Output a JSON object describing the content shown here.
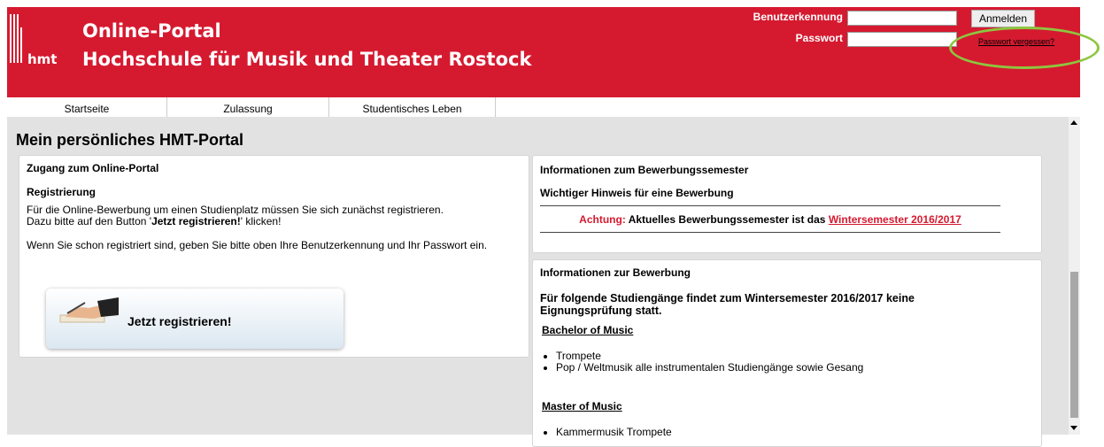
{
  "header": {
    "logo_text": "hmt",
    "title_line1": "Online-Portal",
    "title_line2": "Hochschule für Musik und Theater Rostock",
    "username_label": "Benutzerkennung",
    "password_label": "Passwort",
    "username_value": "",
    "password_value": "",
    "login_button": "Anmelden",
    "forgot_password": "Passwort vergessen?"
  },
  "nav": {
    "tabs": [
      "Startseite",
      "Zulassung",
      "Studentisches Leben"
    ]
  },
  "main": {
    "page_title": "Mein persönliches HMT-Portal",
    "access_panel": {
      "heading": "Zugang zum Online-Portal",
      "subheading": "Registrierung",
      "line1": "Für die Online-Bewerbung um einen Studienplatz müssen Sie sich zunächst registrieren.",
      "line2_prefix": "Dazu bitte auf den Button '",
      "line2_bold": "Jetzt registrieren!",
      "line2_suffix": "' klicken!",
      "line3": "Wenn Sie schon registriert sind, geben Sie bitte oben Ihre Benutzerkennung und Ihr Passwort ein.",
      "register_button": "Jetzt registrieren!"
    },
    "semester_panel": {
      "heading": "Informationen zum Bewerbungssemester",
      "subheading": "Wichtiger Hinweis für eine Bewerbung",
      "notice_label": "Achtung:",
      "notice_text": " Aktuelles Bewerbungssemester ist das ",
      "notice_link": "Wintersemester 2016/2017"
    },
    "application_panel": {
      "heading": "Informationen zur Bewerbung",
      "intro_line1": "Für folgende Studiengänge findet zum Wintersemester 2016/2017 keine",
      "intro_line2": "Eignungsprüfung statt.",
      "bachelor_heading": "Bachelor of Music",
      "bachelor_items": [
        "Trompete",
        "Pop / Weltmusik alle instrumentalen Studiengänge sowie Gesang"
      ],
      "master_heading": "Master of Music",
      "master_items": [
        "Kammermusik Trompete"
      ]
    }
  },
  "colors": {
    "brand_red": "#d51a30",
    "highlight_green": "#8dc63f",
    "content_bg": "#e2e2e2"
  }
}
